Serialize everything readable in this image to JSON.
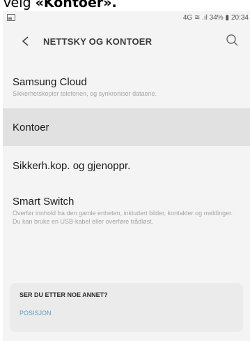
{
  "caption": {
    "prefix": "Velg ",
    "emphasis": "«Kontoer»."
  },
  "statusbar": {
    "indicators": "4G ≋ .ıl 34% ▮",
    "time": "20:34"
  },
  "appbar": {
    "back_icon": "back-arrow-icon",
    "title": "NETTSKY OG KONTOER",
    "search_icon": "search-icon"
  },
  "items": [
    {
      "title": "Samsung Cloud",
      "subtitle": "Sikkerhetskopier telefonen, og synkroniser dataene."
    },
    {
      "title": "Kontoer",
      "subtitle": ""
    },
    {
      "title": "Sikkerh.kop. og gjenoppr.",
      "subtitle": ""
    },
    {
      "title": "Smart Switch",
      "subtitle": "Overfør innhold fra den gamle enheten, inkludert bilder, kontakter og meldinger. Du kan bruke en USB-kabel eller overføre trådløst."
    }
  ],
  "suggestion_card": {
    "heading": "SER DU ETTER NOE ANNET?",
    "link": "POSISJON"
  },
  "colors": {
    "selected_row": "#e1e1e1",
    "link": "#5aa2c6",
    "card_bg": "#ebebeb"
  }
}
